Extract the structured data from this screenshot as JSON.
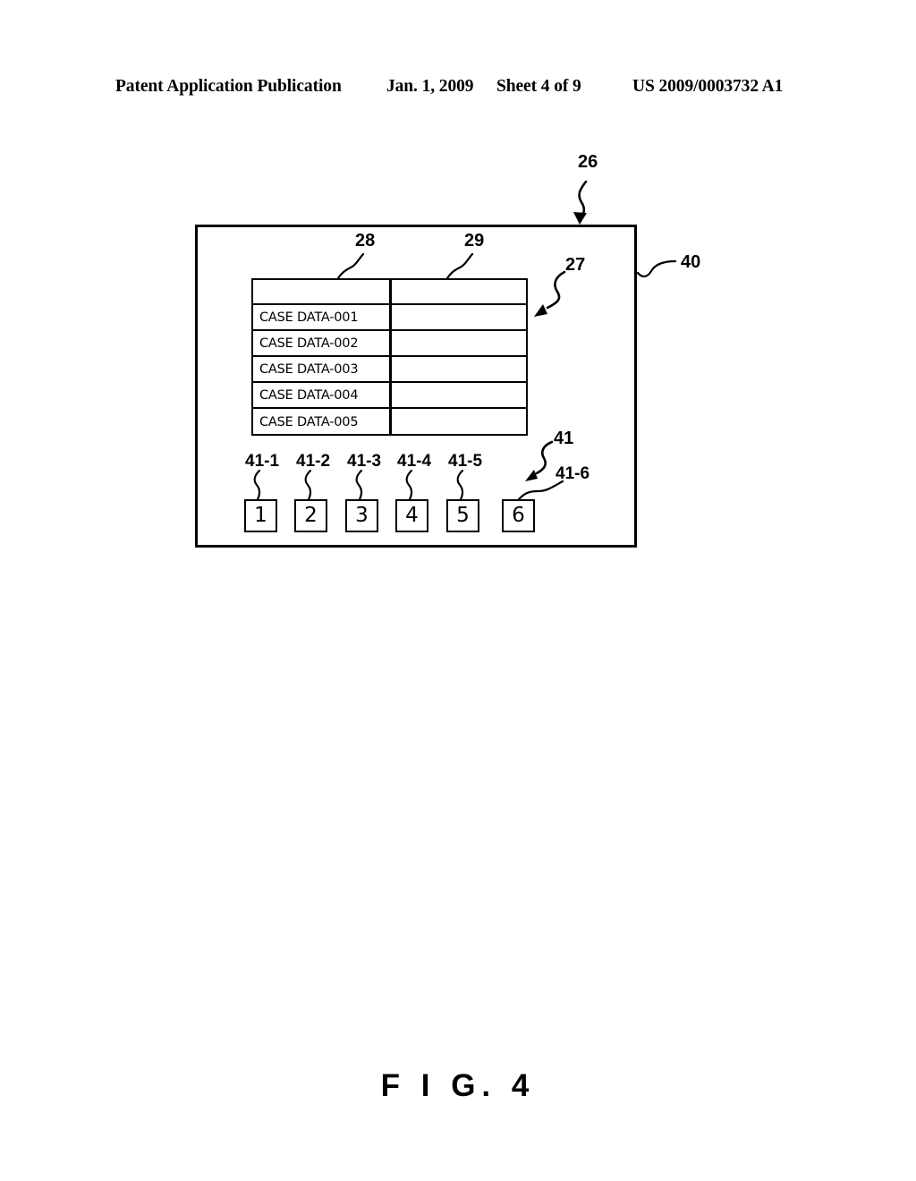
{
  "header": {
    "publication": "Patent Application Publication",
    "date": "Jan. 1, 2009",
    "sheet": "Sheet 4 of 9",
    "patent_number": "US 2009/0003732 A1"
  },
  "figure": {
    "caption": "F I G. 4"
  },
  "diagram": {
    "device_frame_ref": "26",
    "display_panel_ref": "40",
    "table_ref": "27",
    "column_28_ref": "28",
    "column_29_ref": "29",
    "button_group_ref": "41",
    "button_6_ref": "41-6",
    "table": {
      "columns": [
        "",
        ""
      ],
      "header_row": [
        "",
        ""
      ],
      "rows": [
        {
          "name": "CASE DATA-001",
          "value": ""
        },
        {
          "name": "CASE DATA-002",
          "value": ""
        },
        {
          "name": "CASE DATA-003",
          "value": ""
        },
        {
          "name": "CASE DATA-004",
          "value": ""
        },
        {
          "name": "CASE DATA-005",
          "value": ""
        }
      ]
    },
    "buttons": [
      {
        "label": "1",
        "ref": "41-1"
      },
      {
        "label": "2",
        "ref": "41-2"
      },
      {
        "label": "3",
        "ref": "41-3"
      },
      {
        "label": "4",
        "ref": "41-4"
      },
      {
        "label": "5",
        "ref": "41-5"
      },
      {
        "label": "6",
        "ref": "41-6"
      }
    ]
  },
  "colors": {
    "ink": "#000000",
    "paper": "#ffffff"
  }
}
